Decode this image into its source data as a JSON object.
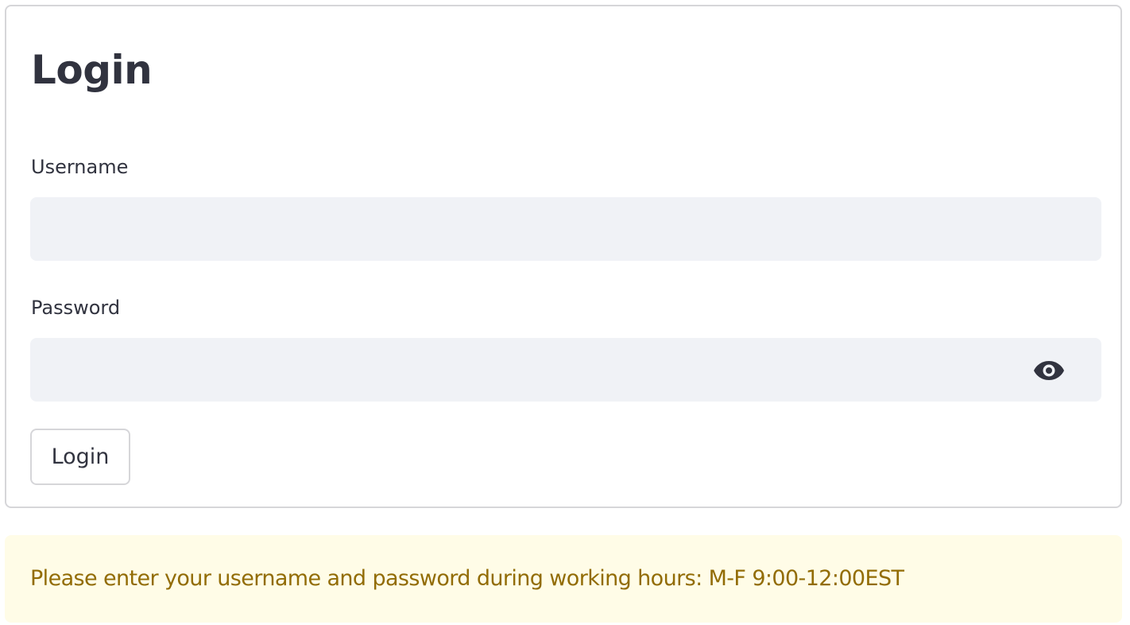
{
  "login_form": {
    "title": "Login",
    "username": {
      "label": "Username",
      "value": "",
      "placeholder": ""
    },
    "password": {
      "label": "Password",
      "value": "",
      "placeholder": "",
      "toggle_icon": "eye-icon"
    },
    "submit_label": "Login"
  },
  "notice": {
    "text": "Please enter your username and password during working hours: M-F 9:00-12:00EST"
  },
  "colors": {
    "text": "#31333f",
    "input_background": "#f0f2f6",
    "border": "#d6d6d9",
    "alert_background": "#fffce7",
    "alert_text": "#926c05"
  }
}
